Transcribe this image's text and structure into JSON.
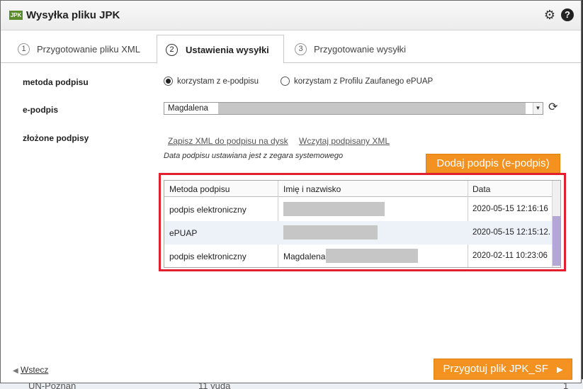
{
  "window": {
    "logo_text": "JPK",
    "title": "Wysyłka pliku JPK"
  },
  "icons": {
    "settings": "gear-icon",
    "help": "question-icon",
    "refresh": "refresh-icon",
    "back": "triangle-left-icon",
    "next": "triangle-right-icon"
  },
  "tabs": [
    {
      "num": "1",
      "label": "Przygotowanie pliku XML",
      "active": false
    },
    {
      "num": "2",
      "label": "Ustawienia wysyłki",
      "active": true
    },
    {
      "num": "3",
      "label": "Przygotowanie wysyłki",
      "active": false
    }
  ],
  "signature_method": {
    "label": "metoda podpisu",
    "options": [
      {
        "label": "korzystam z e-podpisu",
        "selected": true
      },
      {
        "label": "korzystam z Profilu Zaufanego ePUAP",
        "selected": false
      }
    ]
  },
  "e_signature": {
    "label": "e-podpis",
    "value": "Magdalena"
  },
  "signatures": {
    "label": "złożone podpisy",
    "save_link": "Zapisz XML do podpisu na dysk",
    "load_link": "Wczytaj podpisany XML",
    "note": "Data podpisu ustawiana jest z zegara systemowego",
    "add_button": "Dodaj podpis (e-podpis)",
    "columns": [
      "Metoda podpisu",
      "Imię i nazwisko",
      "Data"
    ],
    "rows": [
      {
        "method": "podpis elektroniczny",
        "name": "",
        "date": "2020-05-15 12:16:16"
      },
      {
        "method": "ePUAP",
        "name": "",
        "date": "2020-05-15 12:15:12."
      },
      {
        "method": "podpis elektroniczny",
        "name": "Magdalena",
        "date": "2020-02-11 10:23:06"
      }
    ]
  },
  "footer": {
    "back_label": "Wstecz",
    "next_button": "Przygotuj plik JPK_SF"
  },
  "background": {
    "left_text": "UN-Poznań",
    "mid_text": "11 yuda",
    "right_text": "1"
  },
  "colors": {
    "accent_orange": "#f39221",
    "highlight_red": "#e0202c",
    "logo_green": "#5b8b2a"
  }
}
